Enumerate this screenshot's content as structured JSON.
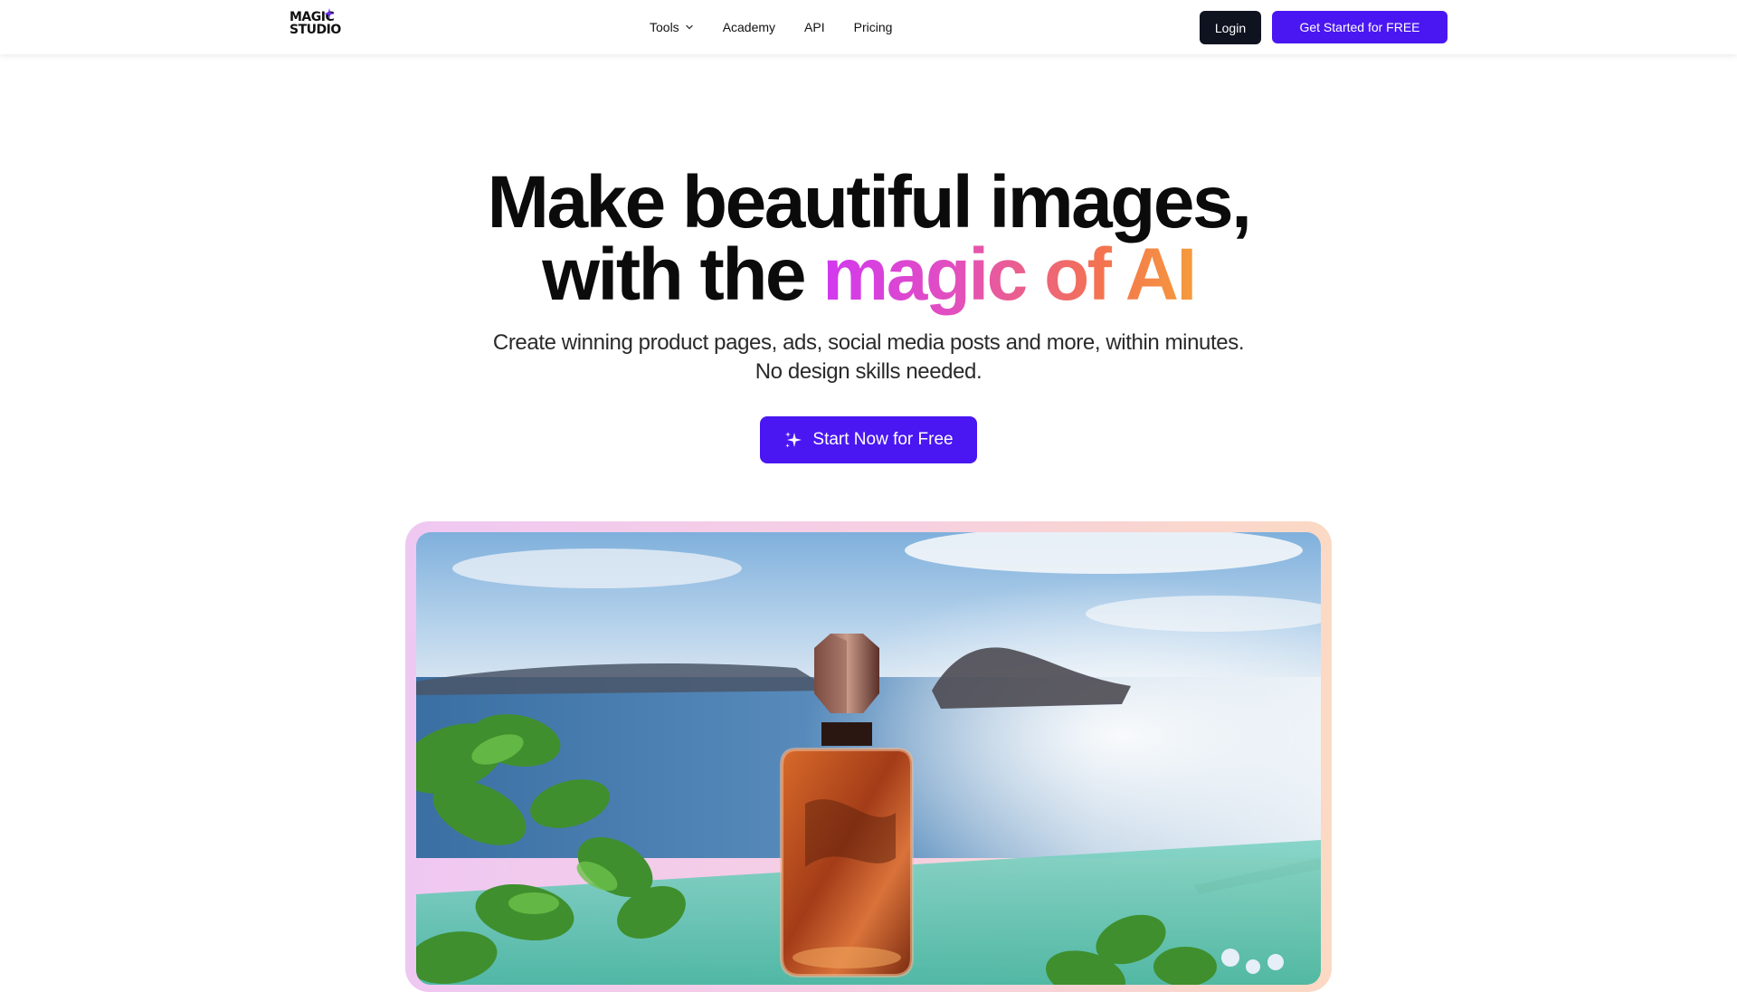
{
  "brand": {
    "logo_line1": "MAGIC",
    "logo_line2": "STUDIO",
    "accent": "#4a17f2",
    "dark": "#0f1320"
  },
  "nav": {
    "links": [
      {
        "label": "Tools",
        "icon": "chevron-down-icon"
      },
      {
        "label": "Academy"
      },
      {
        "label": "API"
      },
      {
        "label": "Pricing"
      }
    ],
    "login_label": "Login",
    "cta_label": "Get Started for FREE"
  },
  "hero": {
    "title_line1": "Make beautiful images,",
    "title_line2_plain": "with the ",
    "title_line2_gradient": "magic of AI",
    "subtitle_line1": "Create winning product pages, ads, social media posts and more, within minutes.",
    "subtitle_line2": "No design skills needed.",
    "cta_label": "Start Now for Free",
    "cta_icon": "sparkle-icon",
    "gradient_colors": [
      "#d138f0",
      "#e24fbf",
      "#f4734f",
      "#f59b3c"
    ]
  },
  "showcase": {
    "image_subject": "perfume-bottle-seaside-photo",
    "frame_colors": [
      "#efc8f2",
      "#f6cfe3",
      "#fbd9c4"
    ]
  }
}
